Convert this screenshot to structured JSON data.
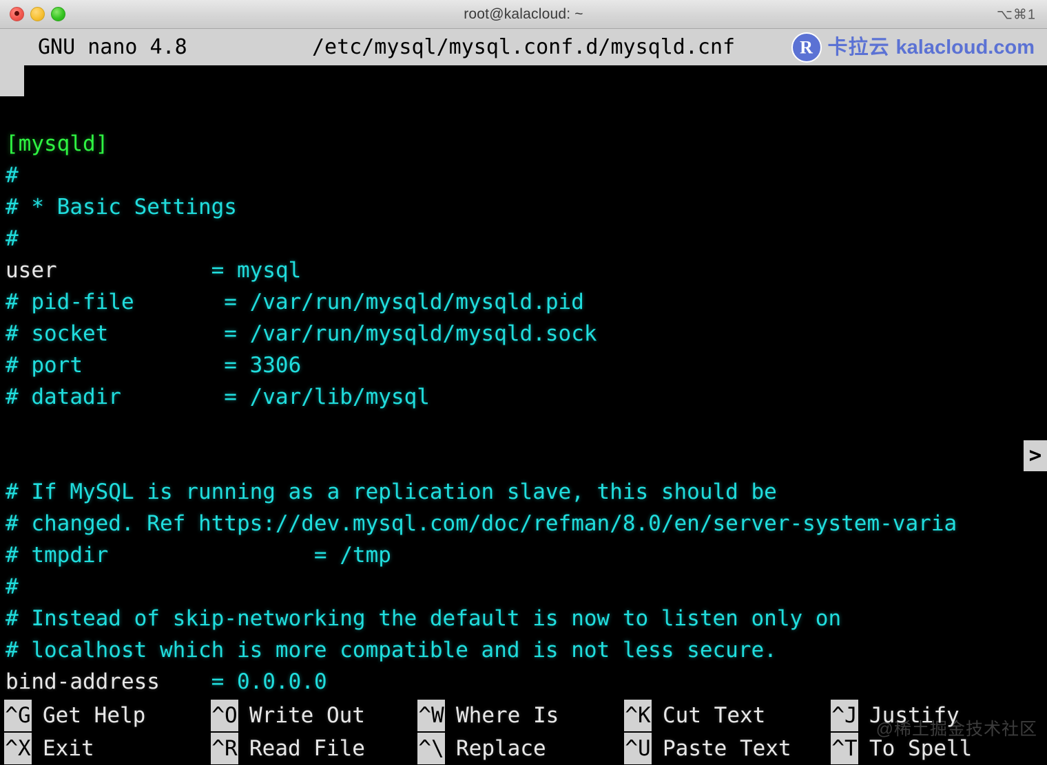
{
  "window": {
    "title": "root@kalacloud: ~",
    "shortcut": "⌥⌘1",
    "traffic_lights": {
      "close": "close-window",
      "minimize": "minimize-window",
      "maximize": "maximize-window"
    },
    "colors": {
      "titlebar_bg": "#d6d6d6",
      "terminal_bg": "#000000",
      "comment": "#20dede",
      "section": "#2ef442",
      "key": "#e8e8e8",
      "inverse_bg": "#d2d2d2",
      "accent_brand": "#5b72d4"
    }
  },
  "nano": {
    "version": "GNU nano 4.8",
    "file_path": "/etc/mysql/mysql.conf.d/mysqld.cnf",
    "continuation_marker": ">",
    "lines": [
      {
        "text": "",
        "type": "blank"
      },
      {
        "text": "[mysqld]",
        "type": "section"
      },
      {
        "text": "#",
        "type": "comment"
      },
      {
        "text": "# * Basic Settings",
        "type": "comment"
      },
      {
        "text": "#",
        "type": "comment"
      },
      {
        "key": "user",
        "eq": "=",
        "value": "mysql",
        "type": "setting"
      },
      {
        "text": "# pid-file       = /var/run/mysqld/mysqld.pid",
        "type": "comment"
      },
      {
        "text": "# socket         = /var/run/mysqld/mysqld.sock",
        "type": "comment"
      },
      {
        "text": "# port           = 3306",
        "type": "comment"
      },
      {
        "text": "# datadir        = /var/lib/mysql",
        "type": "comment"
      },
      {
        "text": "",
        "type": "blank"
      },
      {
        "text": "",
        "type": "blank"
      },
      {
        "text": "# If MySQL is running as a replication slave, this should be",
        "type": "comment"
      },
      {
        "text": "# changed. Ref https://dev.mysql.com/doc/refman/8.0/en/server-system-varia",
        "type": "comment"
      },
      {
        "text": "# tmpdir                = /tmp",
        "type": "comment"
      },
      {
        "text": "#",
        "type": "comment"
      },
      {
        "text": "# Instead of skip-networking the default is now to listen only on",
        "type": "comment"
      },
      {
        "text": "# localhost which is more compatible and is not less secure.",
        "type": "comment"
      },
      {
        "key": "bind-address",
        "eq": "=",
        "value": "0.0.0.0",
        "type": "setting"
      }
    ],
    "help": [
      {
        "key": "^G",
        "label": "Get Help"
      },
      {
        "key": "^O",
        "label": "Write Out"
      },
      {
        "key": "^W",
        "label": "Where Is"
      },
      {
        "key": "^K",
        "label": "Cut Text"
      },
      {
        "key": "^J",
        "label": "Justify"
      },
      {
        "key": "^X",
        "label": "Exit"
      },
      {
        "key": "^R",
        "label": "Read File"
      },
      {
        "key": "^\\",
        "label": "Replace"
      },
      {
        "key": "^U",
        "label": "Paste Text"
      },
      {
        "key": "^T",
        "label": "To Spell"
      }
    ]
  },
  "watermarks": {
    "kalacloud_cn": "卡拉云",
    "kalacloud_en": "kalacloud.com",
    "juejin": "@稀土掘金技术社区"
  }
}
